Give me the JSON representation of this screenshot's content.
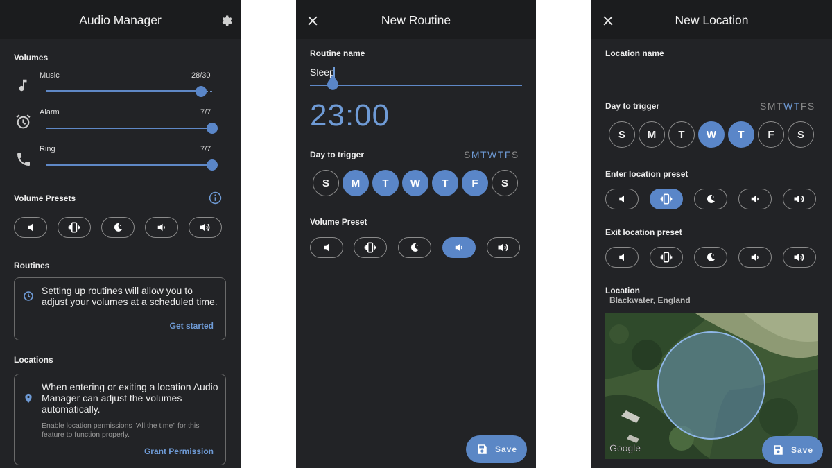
{
  "screen1": {
    "title": "Audio Manager",
    "volumes_heading": "Volumes",
    "volumes": [
      {
        "label": "Music",
        "value_text": "28/30",
        "level": 0.933,
        "icon": "music-note-icon"
      },
      {
        "label": "Alarm",
        "value_text": "7/7",
        "level": 1.0,
        "icon": "alarm-clock-icon"
      },
      {
        "label": "Ring",
        "value_text": "7/7",
        "level": 1.0,
        "icon": "phone-icon"
      }
    ],
    "presets_heading": "Volume Presets",
    "preset_icons": [
      "volume-mute-icon",
      "vibrate-icon",
      "do-not-disturb-moon-icon",
      "volume-low-icon",
      "volume-high-icon"
    ],
    "routines_heading": "Routines",
    "routines_text": "Setting up routines will allow you to adjust your volumes at a scheduled time.",
    "routines_action": "Get started",
    "locations_heading": "Locations",
    "locations_text": "When entering or exiting a location Audio Manager can adjust the volumes automatically.",
    "locations_note": "Enable location permissions \"All the time\" for this feature to function properly.",
    "locations_action": "Grant Permission"
  },
  "screen2": {
    "title": "New Routine",
    "name_label": "Routine name",
    "name_value": "Sleep",
    "time": "23:00",
    "day_label": "Day to trigger",
    "week_letters": [
      "S",
      "M",
      "T",
      "W",
      "T",
      "F",
      "S"
    ],
    "week_active": [
      false,
      true,
      true,
      true,
      true,
      true,
      false
    ],
    "days": [
      {
        "letter": "S",
        "on": false
      },
      {
        "letter": "M",
        "on": true
      },
      {
        "letter": "T",
        "on": true
      },
      {
        "letter": "W",
        "on": true
      },
      {
        "letter": "T",
        "on": true
      },
      {
        "letter": "F",
        "on": true
      },
      {
        "letter": "S",
        "on": false
      }
    ],
    "preset_label": "Volume Preset",
    "preset_selected": 3,
    "save_label": "Save"
  },
  "screen3": {
    "title": "New Location",
    "name_label": "Location name",
    "name_value": "",
    "day_label": "Day to trigger",
    "week_letters": [
      "S",
      "M",
      "T",
      "W",
      "T",
      "F",
      "S"
    ],
    "week_active": [
      false,
      false,
      false,
      true,
      true,
      false,
      false
    ],
    "days": [
      {
        "letter": "S",
        "on": false
      },
      {
        "letter": "M",
        "on": false
      },
      {
        "letter": "T",
        "on": false
      },
      {
        "letter": "W",
        "on": true
      },
      {
        "letter": "T",
        "on": true
      },
      {
        "letter": "F",
        "on": false
      },
      {
        "letter": "S",
        "on": false
      }
    ],
    "enter_label": "Enter location preset",
    "enter_selected": 1,
    "exit_label": "Exit location preset",
    "exit_selected": -1,
    "location_label": "Location",
    "location_value": "Blackwater, England",
    "map_attribution": "Google",
    "save_label": "Save"
  },
  "colors": {
    "accent": "#5a86c8",
    "background": "#222326",
    "appbar": "#1b1c1e"
  }
}
